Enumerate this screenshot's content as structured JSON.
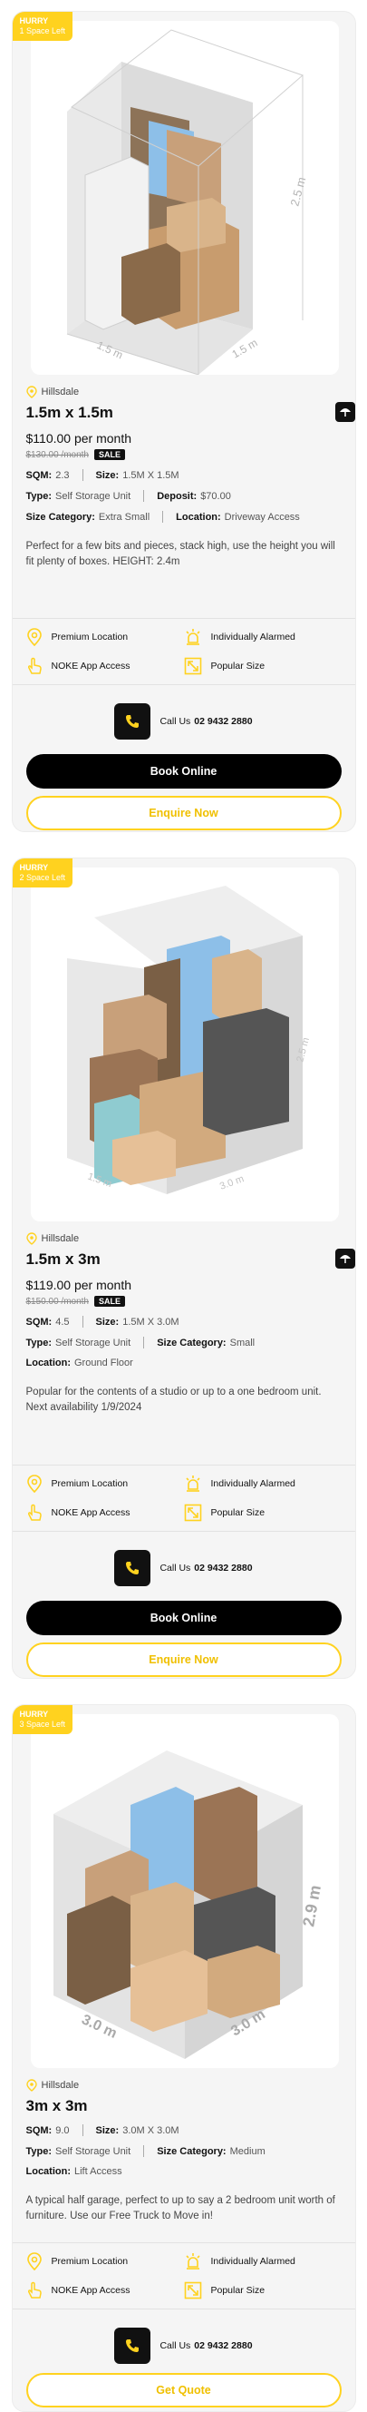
{
  "accent_color": "#ffd21f",
  "units": [
    {
      "badge_title": "HURRY",
      "badge_sub": "1 Space Left",
      "height_label": "2.5 m",
      "width_label": "1.5 m",
      "depth_label": "1.5 m",
      "location": "Hillsdale",
      "title": "1.5m x 1.5m",
      "price": "$110.00 per month",
      "old_price": "$130.00 /month",
      "sale": "SALE",
      "sqm_label": "SQM:",
      "sqm": "2.3",
      "size_label": "Size:",
      "size": "1.5M X 1.5M",
      "type_label": "Type:",
      "type": "Self Storage Unit",
      "deposit_label": "Deposit:",
      "deposit": "$70.00",
      "category_label": "Size Category:",
      "category": "Extra Small",
      "location_label": "Location:",
      "location_value": "Driveway Access",
      "description": "Perfect for a few bits and pieces, stack high, use the height you will fit plenty of boxes. HEIGHT: 2.4m",
      "features": [
        "Premium Location",
        "Individually Alarmed",
        "NOKE App Access",
        "Popular Size"
      ],
      "call_text": "Call Us",
      "phone": "02 9432 2880",
      "book_label": "Book Online",
      "enquire_label": "Enquire Now"
    },
    {
      "badge_title": "HURRY",
      "badge_sub": "2 Space Left",
      "height_label": "2.5 m",
      "width_label": "1.5 m",
      "depth_label": "3.0 m",
      "location": "Hillsdale",
      "title": "1.5m x 3m",
      "price": "$119.00 per month",
      "old_price": "$150.00 /month",
      "sale": "SALE",
      "sqm_label": "SQM:",
      "sqm": "4.5",
      "size_label": "Size:",
      "size": "1.5M X 3.0M",
      "type_label": "Type:",
      "type": "Self Storage Unit",
      "category_label": "Size Category:",
      "category": "Small",
      "location_label": "Location:",
      "location_value": "Ground Floor",
      "description": "Popular for the contents of a studio or up to a one bedroom unit. Next availability 1/9/2024",
      "features": [
        "Premium Location",
        "Individually Alarmed",
        "NOKE App Access",
        "Popular Size"
      ],
      "call_text": "Call Us",
      "phone": "02 9432 2880",
      "book_label": "Book Online",
      "enquire_label": "Enquire Now"
    },
    {
      "badge_title": "HURRY",
      "badge_sub": "3 Space Left",
      "height_label": "2.9 m",
      "width_label": "3.0 m",
      "depth_label": "3.0 m",
      "location": "Hillsdale",
      "title": "3m x 3m",
      "sqm_label": "SQM:",
      "sqm": "9.0",
      "size_label": "Size:",
      "size": "3.0M X 3.0M",
      "type_label": "Type:",
      "type": "Self Storage Unit",
      "category_label": "Size Category:",
      "category": "Medium",
      "location_label": "Location:",
      "location_value": "Lift Access",
      "description": "A typical half garage, perfect to up to say a 2 bedroom unit worth of furniture. Use our Free Truck to Move in!",
      "features": [
        "Premium Location",
        "Individually Alarmed",
        "NOKE App Access",
        "Popular Size"
      ],
      "call_text": "Call Us",
      "phone": "02 9432 2880",
      "quote_label": "Get Quote"
    }
  ]
}
